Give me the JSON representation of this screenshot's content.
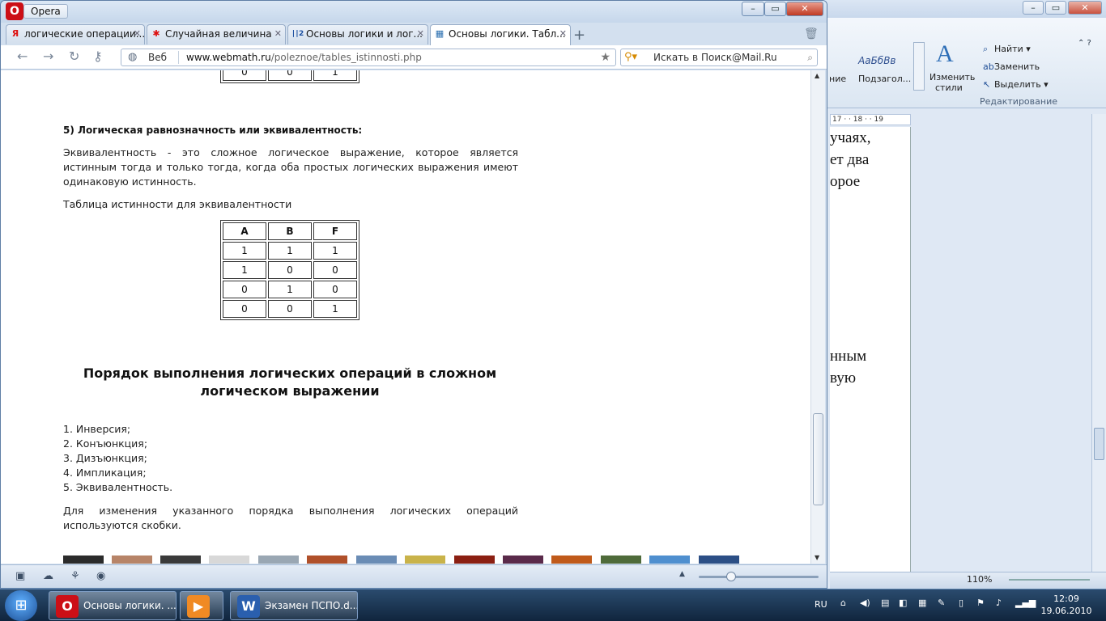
{
  "opera": {
    "menu_label": "Opera",
    "tabs": [
      {
        "label": "логические операции...",
        "icon": "Я"
      },
      {
        "label": "Случайная величина",
        "icon": "✱"
      },
      {
        "label": "Основы логики и лог...",
        "icon": "∣∣2"
      },
      {
        "label": "Основы логики. Табл...",
        "icon": "▦"
      }
    ],
    "address": {
      "prefix": "Веб",
      "domain": "www.webmath.ru",
      "path": "/poleznoe/tables_istinnosti.php"
    },
    "search_placeholder": "Искать в Поиск@Mail.Ru"
  },
  "page": {
    "top_table_last_row": [
      "0",
      "0",
      "1"
    ],
    "section_heading": "5) Логическая равнозначность или эквивалентность:",
    "definition": "Эквивалентность - это сложное логическое выражение, которое является истинным тогда и только тогда, когда оба простых логических выражения имеют одинаковую истинность.",
    "table_caption": "Таблица истинности для эквивалентности",
    "table": {
      "headers": [
        "A",
        "B",
        "F"
      ],
      "rows": [
        [
          "1",
          "1",
          "1"
        ],
        [
          "1",
          "0",
          "0"
        ],
        [
          "0",
          "1",
          "0"
        ],
        [
          "0",
          "0",
          "1"
        ]
      ]
    },
    "order_heading": "Порядок выполнения логических операций в сложном логическом выражении",
    "order_list": [
      "1. Инверсия;",
      "2. Конъюнкция;",
      "3. Дизъюнкция;",
      "4. Импликация;",
      "5. Эквивалентность."
    ],
    "note": "Для изменения указанного порядка выполнения логических операций используются скобки."
  },
  "word": {
    "style_label_1": "ние",
    "style_label_2": "Подзагол...",
    "style_preview": "АаБбВв",
    "change_styles": [
      "Изменить",
      "стили"
    ],
    "find": "Найти",
    "replace": "Заменить",
    "select": "Выделить",
    "group_label": "Редактирование",
    "ruler": "17 · · 18 · · 19",
    "doc_lines": [
      "учаях,",
      "ет два",
      "орое",
      "нным",
      "вую"
    ],
    "zoom_label": "110%"
  },
  "taskbar": {
    "items": [
      "Основы логики. ...",
      "",
      "Экзамен ПСПО.d..."
    ],
    "lang": "RU",
    "time": "12:09",
    "date": "19.06.2010"
  },
  "colors": {
    "opera_red": "#cc0f16",
    "word_blue": "#2f6fb7"
  }
}
